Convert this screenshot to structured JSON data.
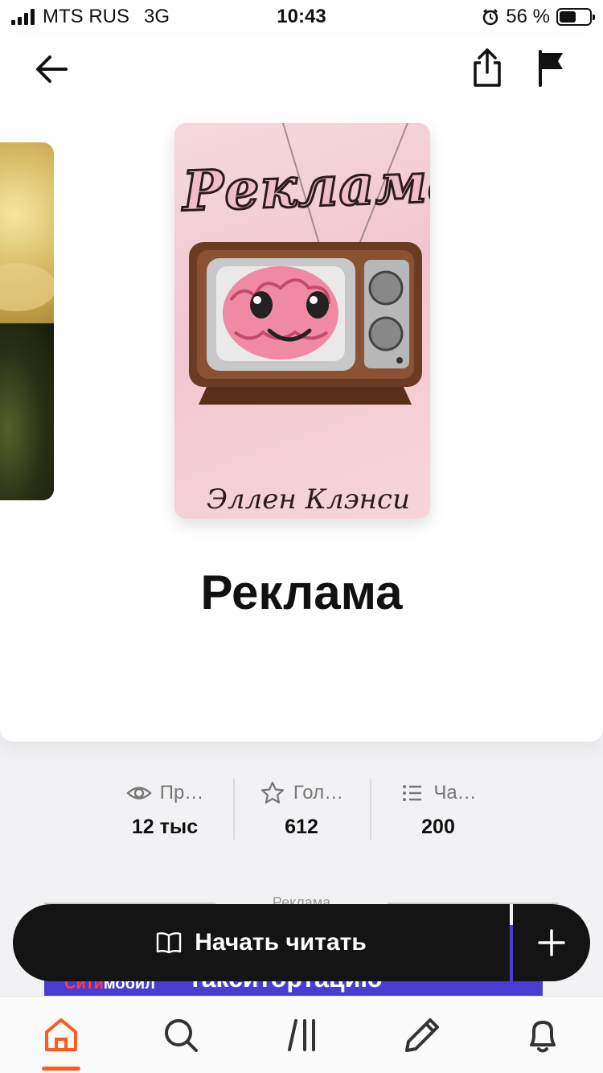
{
  "status_bar": {
    "carrier": "MTS RUS",
    "network": "3G",
    "time": "10:43",
    "battery": "56 %",
    "battery_level": 0.56
  },
  "nav": {
    "back_icon": "arrow-left-icon",
    "share_icon": "share-icon",
    "report_icon": "flag-icon"
  },
  "book": {
    "cover_title": "Реклама",
    "cover_author": "Эллен Клэнси",
    "title": "Реклама"
  },
  "stats": [
    {
      "icon": "eye-icon",
      "label": "Пр…",
      "value": "12 тыс"
    },
    {
      "icon": "star-icon",
      "label": "Гол…",
      "value": "612"
    },
    {
      "icon": "list-icon",
      "label": "Ча…",
      "value": "200"
    }
  ],
  "ad": {
    "label": "Реклама",
    "brand_prefix": "Сити",
    "brand_suffix": "мобил",
    "slogan": "такситортацию",
    "color": "#4a3bd3"
  },
  "actions": {
    "read_label": "Начать читать",
    "read_icon": "book-open-icon",
    "add_icon": "plus-icon"
  },
  "tabbar": {
    "active_color": "#ff5a1f",
    "items": [
      "home-icon",
      "search-icon",
      "library-icon",
      "pencil-icon",
      "bell-icon"
    ],
    "active_index": 0
  }
}
